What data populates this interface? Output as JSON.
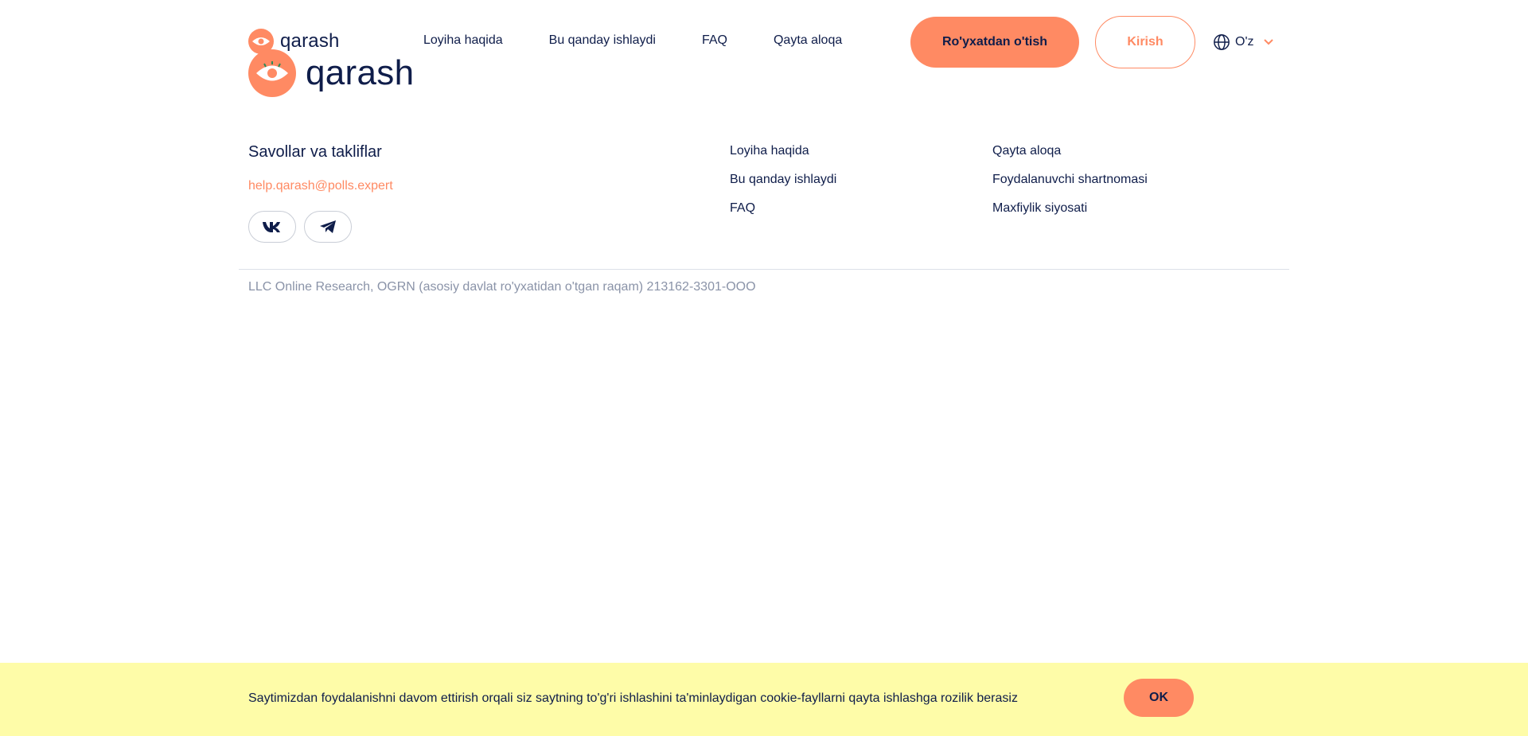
{
  "header": {
    "logo_small_text": "qarash",
    "logo_big_text": "qarash",
    "nav": [
      {
        "label": "Loyiha haqida"
      },
      {
        "label": "Bu qanday ishlaydi"
      },
      {
        "label": "FAQ"
      },
      {
        "label": "Qayta aloqa"
      }
    ],
    "register_label": "Ro'yxatdan o'tish",
    "login_label": "Kirish",
    "language": "O'z"
  },
  "footer": {
    "title": "Savollar va takliflar",
    "email": "help.qarash@polls.expert",
    "links_col1": [
      {
        "label": "Loyiha haqida"
      },
      {
        "label": "Bu qanday ishlaydi"
      },
      {
        "label": "FAQ"
      }
    ],
    "links_col2": [
      {
        "label": "Qayta aloqa"
      },
      {
        "label": "Foydalanuvchi shartnomasi"
      },
      {
        "label": "Maxfiylik siyosati"
      }
    ],
    "legal": "LLC Online Research, OGRN (asosiy davlat ro'yxatidan o'tgan raqam) 213162-3301-OOO"
  },
  "cookie": {
    "text": "Saytimizdan foydalanishni davom ettirish orqali siz saytning to'g'ri ishlashini ta'minlaydigan cookie-fayllarni qayta ishlashga rozilik berasiz",
    "ok_label": "OK"
  },
  "colors": {
    "accent": "#ff8a63",
    "text": "#0f1d4a",
    "muted": "#8a93a8",
    "cookie_bg": "#fefca8"
  },
  "icons": [
    "eye-logo-icon",
    "globe-icon",
    "chevron-down-icon",
    "vk-icon",
    "telegram-icon"
  ]
}
